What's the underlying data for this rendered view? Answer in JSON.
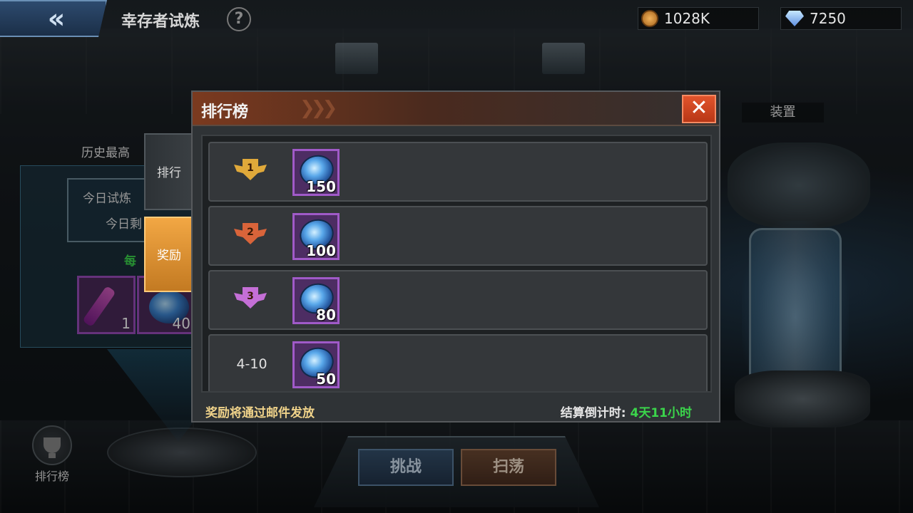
{
  "header": {
    "title": "幸存者试炼",
    "help_glyph": "?",
    "back_glyph": "«"
  },
  "resources": {
    "gold": "1028K",
    "diamonds": "7250"
  },
  "background": {
    "history_label": "历史最高",
    "today_trial_label": "今日试炼",
    "today_remaining_label": "今日剩",
    "daily_label": "每",
    "items": [
      {
        "count": "1"
      },
      {
        "count": "40"
      }
    ],
    "equip_label": "装置"
  },
  "bottom": {
    "challenge_label": "挑战",
    "sweep_label": "扫荡",
    "rankings_button_label": "排行榜"
  },
  "modal": {
    "title": "排行榜",
    "close_glyph": "✕",
    "tabs": [
      {
        "label": "排行",
        "active": false
      },
      {
        "label": "奖励",
        "active": true
      }
    ],
    "rows": [
      {
        "rank": "1",
        "badge_color": "#e0a93a",
        "reward_count": "150"
      },
      {
        "rank": "2",
        "badge_color": "#d9643a",
        "reward_count": "100"
      },
      {
        "rank": "3",
        "badge_color": "#c46fd6",
        "reward_count": "80"
      },
      {
        "rank": "4-10",
        "badge_color": "",
        "reward_count": "50"
      }
    ],
    "footer_note": "奖励将通过邮件发放",
    "countdown_label": "结算倒计时:",
    "countdown_value": "4天11小时"
  },
  "colors": {
    "accent_orange": "#f2a744",
    "countdown_green": "#3bd44b",
    "item_frame_purple": "#a05ac8",
    "close_red": "#e2542c"
  }
}
